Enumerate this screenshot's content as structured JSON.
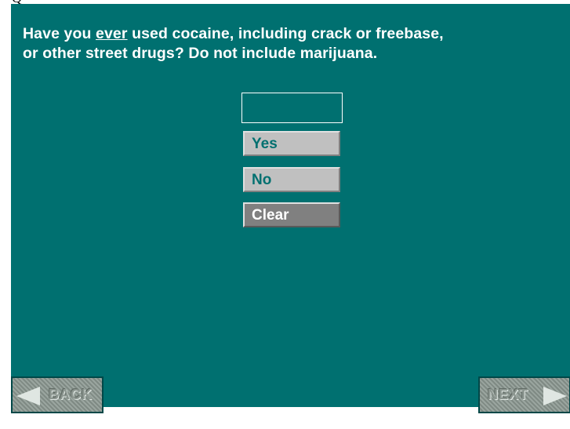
{
  "question": {
    "before": "Have you ",
    "emphasis": "ever",
    "after_line1": " used cocaine, including crack or freebase,",
    "line2": "or other street drugs? Do not include marijuana."
  },
  "answer": {
    "value": ""
  },
  "options": {
    "yes": "Yes",
    "no": "No",
    "clear": "Clear"
  },
  "nav": {
    "back": "BACK",
    "next": "NEXT",
    "back_icon": "arrow-left-icon",
    "next_icon": "arrow-right-icon"
  },
  "colors": {
    "background": "#007070",
    "option_button": "#c0c0c0",
    "clear_button": "#808080",
    "text": "#ffffff"
  }
}
